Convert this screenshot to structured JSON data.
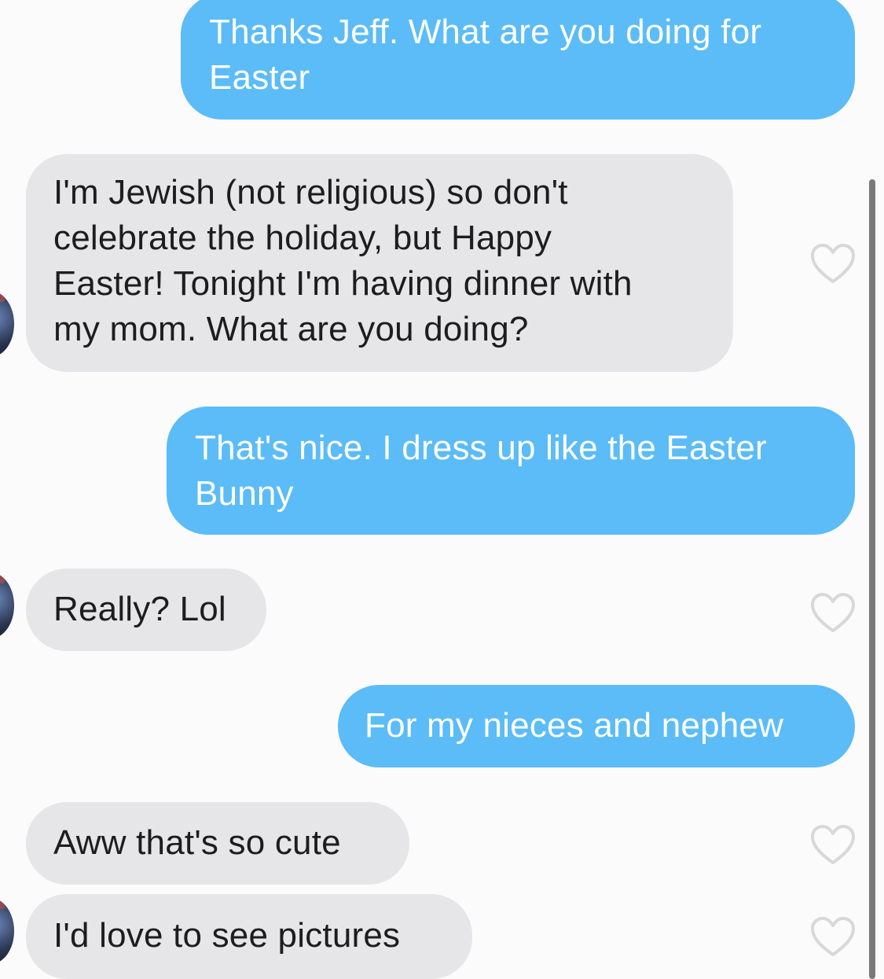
{
  "colors": {
    "sent_bubble": "#5bbcf7",
    "received_bubble": "#e6e6e8",
    "heart_outline": "#d8d8d8",
    "scrollbar": "#7a7a7a"
  },
  "messages": [
    {
      "direction": "sent",
      "text": "Thanks Jeff. What are you doing for\nEaster"
    },
    {
      "direction": "received",
      "text": "I'm Jewish (not religious) so don't\ncelebrate the holiday, but Happy\nEaster! Tonight I'm having dinner with\nmy mom. What are you doing?",
      "like_icon": "heart-outline-icon"
    },
    {
      "direction": "sent",
      "text": "That's nice. I dress up like the Easter\nBunny"
    },
    {
      "direction": "received",
      "text": "Really? Lol",
      "like_icon": "heart-outline-icon"
    },
    {
      "direction": "sent",
      "text": "For my nieces and nephew"
    },
    {
      "direction": "received",
      "text": "Aww that's so cute",
      "like_icon": "heart-outline-icon"
    },
    {
      "direction": "received",
      "text": "I'd love to see pictures",
      "like_icon": "heart-outline-icon"
    }
  ]
}
